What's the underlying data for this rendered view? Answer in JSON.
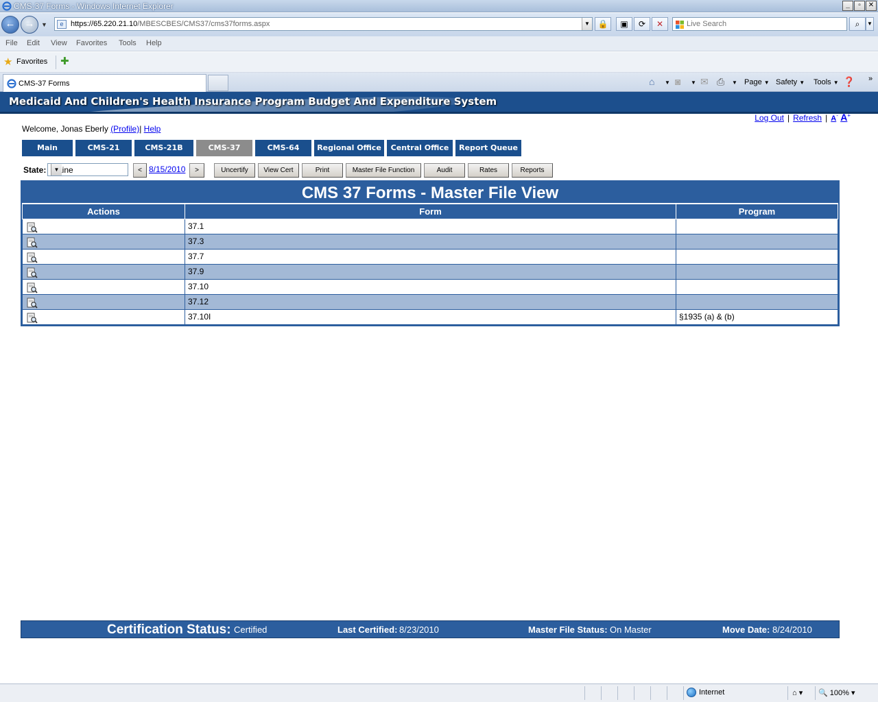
{
  "browser": {
    "window_title": "CMS-37 Forms - Windows Internet Explorer",
    "url_host": "https://65.220.21.10",
    "url_path": "/MBESCBES/CMS37/cms37forms.aspx",
    "search_placeholder": "Live Search",
    "menu": [
      "File",
      "Edit",
      "View",
      "Favorites",
      "Tools",
      "Help"
    ],
    "favorites_label": "Favorites",
    "tab_title": "CMS-37 Forms",
    "commands": {
      "page": "Page",
      "safety": "Safety",
      "tools": "Tools"
    },
    "status_zone": "Internet",
    "zoom": "100%"
  },
  "site": {
    "banner_title": "Medicaid And Children's Health Insurance Program Budget And Expenditure System",
    "links": {
      "logout": "Log Out",
      "refresh": "Refresh",
      "font_small": "A",
      "font_large": "A"
    },
    "welcome_prefix": "Welcome, Jonas Eberly",
    "profile_link": "(Profile)",
    "help_link": "Help",
    "nav_tabs": [
      "Main",
      "CMS-21",
      "CMS-21B",
      "CMS-37",
      "CMS-64",
      "Regional Office",
      "Central Office",
      "Report Queue"
    ],
    "active_tab": "CMS-37"
  },
  "toolbar": {
    "state_label": "State:",
    "state_value": "Maine",
    "prev": "<",
    "date": "8/15/2010",
    "next": ">",
    "buttons": [
      "Uncertify",
      "View Cert",
      "Print",
      "Master File Function",
      "Audit",
      "Rates",
      "Reports"
    ]
  },
  "panel": {
    "title": "CMS 37 Forms - Master File View",
    "columns": [
      "Actions",
      "Form",
      "Program"
    ],
    "rows": [
      {
        "form": "37.1",
        "program": ""
      },
      {
        "form": "37.3",
        "program": ""
      },
      {
        "form": "37.7",
        "program": ""
      },
      {
        "form": "37.9",
        "program": ""
      },
      {
        "form": "37.10",
        "program": ""
      },
      {
        "form": "37.12",
        "program": ""
      },
      {
        "form": "37.10I",
        "program": "§1935 (a) & (b)"
      }
    ]
  },
  "status": {
    "cert_label": "Certification Status:",
    "cert_value": "Certified",
    "last_label": "Last Certified:",
    "last_value": "8/23/2010",
    "master_label": "Master File Status:",
    "master_value": "On Master",
    "move_label": "Move Date:",
    "move_value": "8/24/2010"
  },
  "colors": {
    "header_blue": "#2c5e9e",
    "banner_blue": "#1c4f8d",
    "alt_row": "#a3b9d6",
    "active_tab": "#8c8c8c"
  }
}
